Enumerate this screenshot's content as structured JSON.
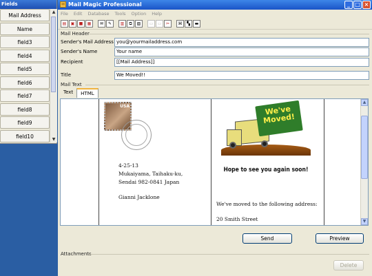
{
  "fields_panel": {
    "title": "Fields",
    "items": [
      "Mail Address",
      "Name",
      "field3",
      "field4",
      "field5",
      "field6",
      "field7",
      "field8",
      "field9",
      "field10"
    ]
  },
  "window": {
    "title": "Mail Magic Professional",
    "controls": {
      "minimize": "_",
      "maximize": "□",
      "close": "×"
    }
  },
  "menu": [
    "File",
    "Edit",
    "Database",
    "Tools",
    "Option",
    "Help"
  ],
  "toolbar": {
    "icons": [
      "new-icon",
      "open-icon",
      "save-icon",
      "print-icon",
      "mail-icon",
      "import-icon",
      "export-icon",
      "copy-icon",
      "paste-icon",
      "table-icon",
      "grid-icon",
      "tools-icon",
      "settings-icon",
      "layout-icon",
      "layout2-icon",
      "send-icon"
    ]
  },
  "mail_header": {
    "section_label": "Mail Header",
    "sender_address_label": "Sender's Mail Address",
    "sender_address_value": "you@yourmailaddress.com",
    "sender_name_label": "Sender's Name",
    "sender_name_value": "Your name",
    "recipient_label": "Recipient",
    "recipient_value": "[[Mail Address]]",
    "title_label": "Title",
    "title_value": "We Moved!!"
  },
  "mail_text": {
    "section_label": "Mail Text",
    "tabs": [
      "Text",
      "HTML"
    ],
    "active_tab": "HTML",
    "preview": {
      "stamp_label": "USA",
      "address_lines": [
        "4-25-13",
        "Mukaiyama, Taihaku-ku,",
        "Sendai 982-0841 Japan"
      ],
      "name": "Gianni Jacklone",
      "sign_text": "We've Moved!",
      "hope_text": "Hope to see you again soon!",
      "moved_text": "We've moved to the following address:",
      "street": "20 Smith Street"
    }
  },
  "buttons": {
    "send": "Send",
    "preview": "Preview",
    "delete": "Delete"
  },
  "attachments": {
    "section_label": "Attachments"
  }
}
